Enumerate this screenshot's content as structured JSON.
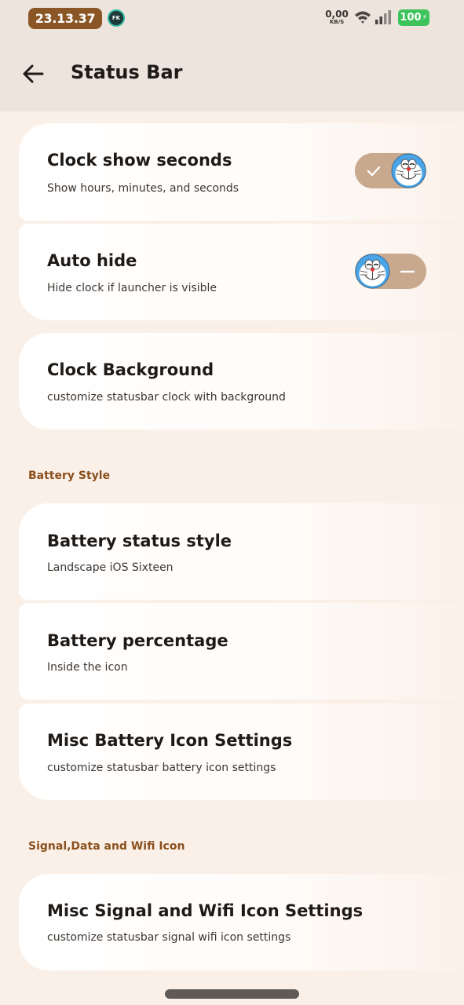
{
  "statusbar": {
    "time": "23.13.37",
    "app_badge": "FK",
    "net_speed_value": "0,00",
    "net_speed_unit": "KB/S",
    "battery": "100"
  },
  "appbar": {
    "title": "Status Bar"
  },
  "sections": [
    {
      "items": [
        {
          "title": "Clock show seconds",
          "subtitle": "Show hours, minutes, and seconds",
          "toggle": true
        },
        {
          "title": "Auto hide",
          "subtitle": "Hide clock if launcher is visible",
          "toggle": false
        },
        {
          "title": "Clock Background",
          "subtitle": "customize statusbar clock with background"
        }
      ]
    },
    {
      "header": "Battery Style",
      "items": [
        {
          "title": "Battery status style",
          "subtitle": "Landscape iOS Sixteen"
        },
        {
          "title": "Battery percentage",
          "subtitle": "Inside the icon"
        },
        {
          "title": "Misc Battery Icon Settings",
          "subtitle": "customize statusbar battery icon settings"
        }
      ]
    },
    {
      "header": "Signal,Data and Wifi Icon",
      "items": [
        {
          "title": "Misc Signal and Wifi Icon Settings",
          "subtitle": "customize statusbar signal wifi icon settings"
        }
      ]
    }
  ],
  "colors": {
    "accent": "#8a4f1c",
    "toggle_track": "#c8a98d",
    "background": "#fbf0e8"
  },
  "icons": {
    "back": "arrow-left-icon",
    "wifi": "wifi-icon",
    "signal": "signal-icon",
    "battery": "battery-charging-icon",
    "toggle_knob": "doraemon-face-icon"
  }
}
